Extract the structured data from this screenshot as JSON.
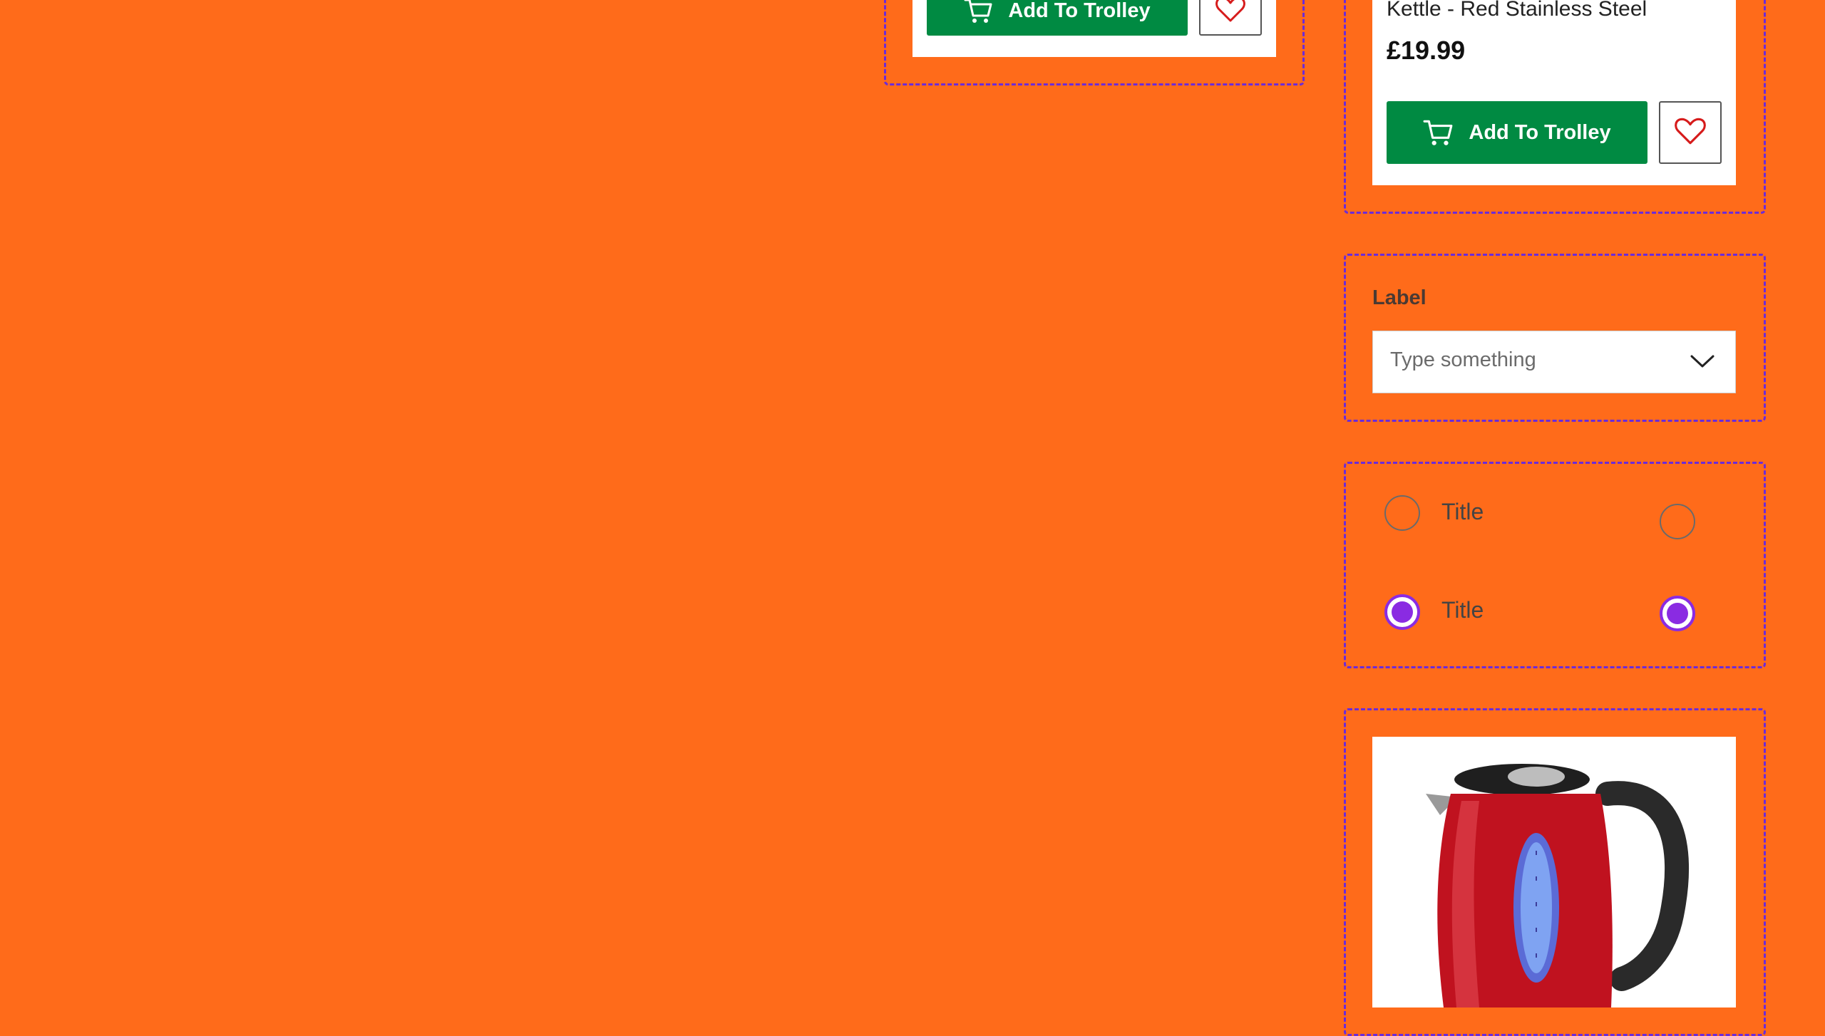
{
  "colors": {
    "background": "#ff6b1a",
    "frame_border": "#6b2bd9",
    "add_button": "#008a42",
    "radio_selected": "#8a2be2",
    "heart": "#d61b1b"
  },
  "product_card_left": {
    "add_button_label": "Add To Trolley",
    "cart_icon": "cart-icon",
    "wishlist_icon": "heart-icon"
  },
  "product_card_right": {
    "title": "Kettle - Red Stainless Steel",
    "price": "£19.99",
    "add_button_label": "Add To Trolley",
    "cart_icon": "cart-icon",
    "wishlist_icon": "heart-icon"
  },
  "select_field": {
    "label": "Label",
    "placeholder": "Type something",
    "chevron_icon": "chevron-down-icon"
  },
  "radio_group": {
    "items": [
      {
        "title": "Title",
        "selected": false
      },
      {
        "title": "Title",
        "selected": true
      }
    ],
    "standalone": [
      {
        "selected": false
      },
      {
        "selected": true
      }
    ]
  },
  "product_image": {
    "icon": "kettle-image"
  }
}
